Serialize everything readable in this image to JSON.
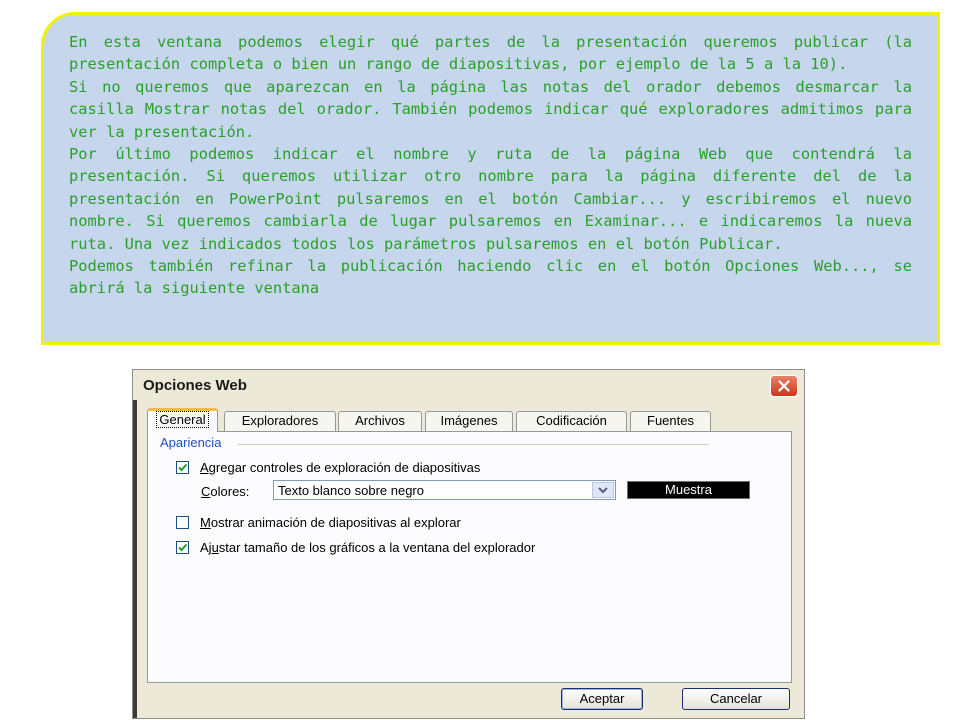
{
  "callout": {
    "paragraphs": [
      "En esta ventana podemos elegir qué partes de la presentación queremos publicar (la presentación completa o bien un rango de diapositivas, por ejemplo de la 5 a la 10).",
      "Si no queremos que aparezcan en la página las notas del orador debemos desmarcar la casilla Mostrar notas del orador. También podemos indicar qué exploradores admitimos para ver la presentación.",
      "Por último podemos indicar el nombre y ruta de la página Web que contendrá la presentación. Si queremos utilizar otro nombre para la página diferente del de la presentación en PowerPoint pulsaremos en el botón Cambiar... y escribiremos el nuevo nombre. Si queremos cambiarla de lugar pulsaremos en Examinar... e indicaremos la nueva ruta. Una vez indicados todos los parámetros pulsaremos en el botón Publicar.",
      "Podemos también refinar la publicación haciendo clic en el botón Opciones Web..., se abrirá la siguiente ventana"
    ],
    "text_color": "#2aa02a",
    "background_color": "#c6d6ec",
    "border_color": "#f2f200"
  },
  "dialog": {
    "title": "Opciones Web",
    "tabs": [
      "General",
      "Exploradores",
      "Archivos",
      "Imágenes",
      "Codificación",
      "Fuentes"
    ],
    "active_tab": "General",
    "group_title": "Apariencia",
    "options": {
      "nav_controls": {
        "pre": "",
        "key": "A",
        "post": "gregar controles de exploración de diapositivas",
        "checked": true
      },
      "colors_label": {
        "pre": "",
        "key": "C",
        "post": "olores:"
      },
      "colors_value": "Texto blanco sobre negro",
      "preview_text": "Muestra",
      "animation": {
        "pre": "",
        "key": "M",
        "post": "ostrar animación de diapositivas al explorar",
        "checked": false
      },
      "resize": {
        "pre": "Aj",
        "key": "u",
        "post": "star tamaño de los gráficos a la ventana del explorador",
        "checked": true
      }
    },
    "buttons": {
      "ok": "Aceptar",
      "cancel": "Cancelar"
    },
    "icons": {
      "close": "close-icon",
      "dropdown": "chevron-down-icon",
      "check": "checkmark-icon"
    },
    "colors": {
      "group_title": "#1f4fc6",
      "active_tab_accent": "#f5b94a",
      "close_button": "#c9371b"
    }
  }
}
